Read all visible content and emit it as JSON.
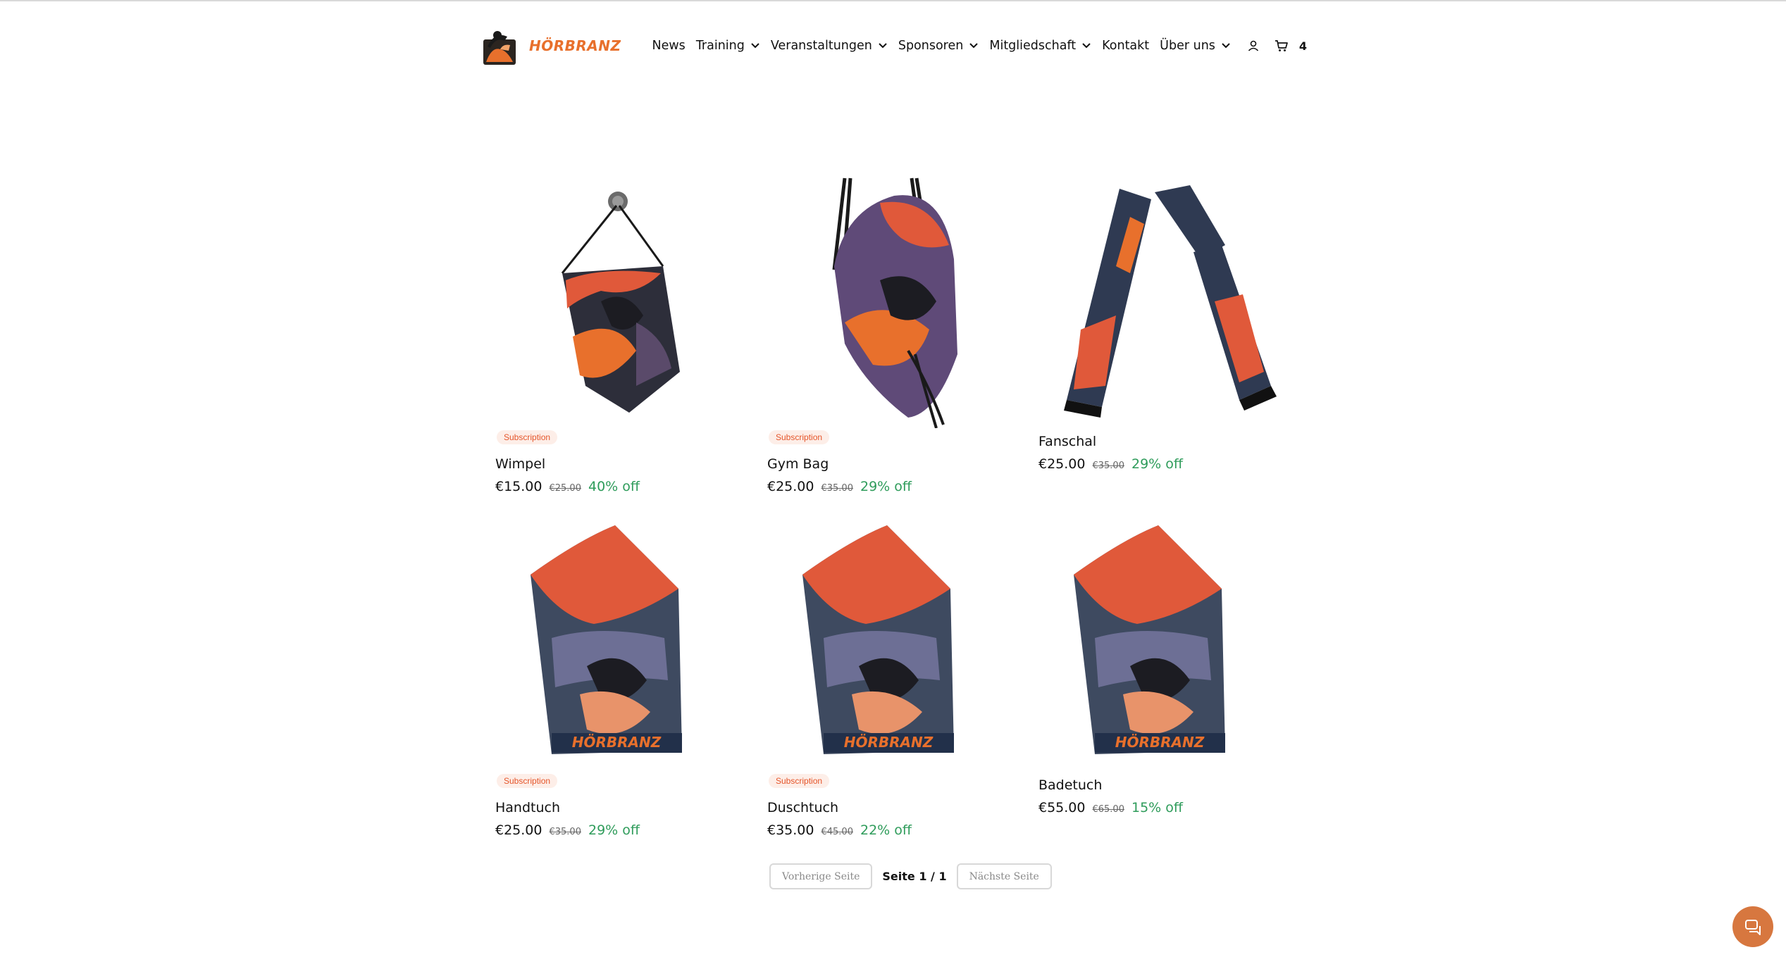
{
  "brand": {
    "logo_text": "HÖRBRANZ",
    "accent_color": "#e8702c"
  },
  "nav": {
    "items": [
      {
        "label": "News",
        "has_dropdown": false
      },
      {
        "label": "Training",
        "has_dropdown": true
      },
      {
        "label": "Veranstaltungen",
        "has_dropdown": true
      },
      {
        "label": "Sponsoren",
        "has_dropdown": true
      },
      {
        "label": "Mitgliedschaft",
        "has_dropdown": true
      },
      {
        "label": "Kontakt",
        "has_dropdown": false
      },
      {
        "label": "Über uns",
        "has_dropdown": true
      }
    ],
    "user_icon": "user-icon",
    "cart_icon": "cart-icon",
    "cart_count": "4"
  },
  "products": [
    {
      "badge": "Subscription",
      "name": "Wimpel",
      "price": "€15.00",
      "old_price": "€25.00",
      "discount": "40% off",
      "image": "pennant"
    },
    {
      "badge": "Subscription",
      "name": "Gym Bag",
      "price": "€25.00",
      "old_price": "€35.00",
      "discount": "29% off",
      "image": "gymbag"
    },
    {
      "badge": "",
      "name": "Fanschal",
      "price": "€25.00",
      "old_price": "€35.00",
      "discount": "29% off",
      "image": "scarf"
    },
    {
      "badge": "Subscription",
      "name": "Handtuch",
      "price": "€25.00",
      "old_price": "€35.00",
      "discount": "29% off",
      "image": "towel"
    },
    {
      "badge": "Subscription",
      "name": "Duschtuch",
      "price": "€35.00",
      "old_price": "€45.00",
      "discount": "22% off",
      "image": "towel"
    },
    {
      "badge": "",
      "name": "Badetuch",
      "price": "€55.00",
      "old_price": "€65.00",
      "discount": "15% off",
      "image": "towel"
    }
  ],
  "pagination": {
    "prev_label": "Vorherige Seite",
    "page_info": "Seite 1 / 1",
    "next_label": "Nächste Seite"
  },
  "chat": {
    "icon": "chat-icon",
    "color": "#d7773f"
  }
}
